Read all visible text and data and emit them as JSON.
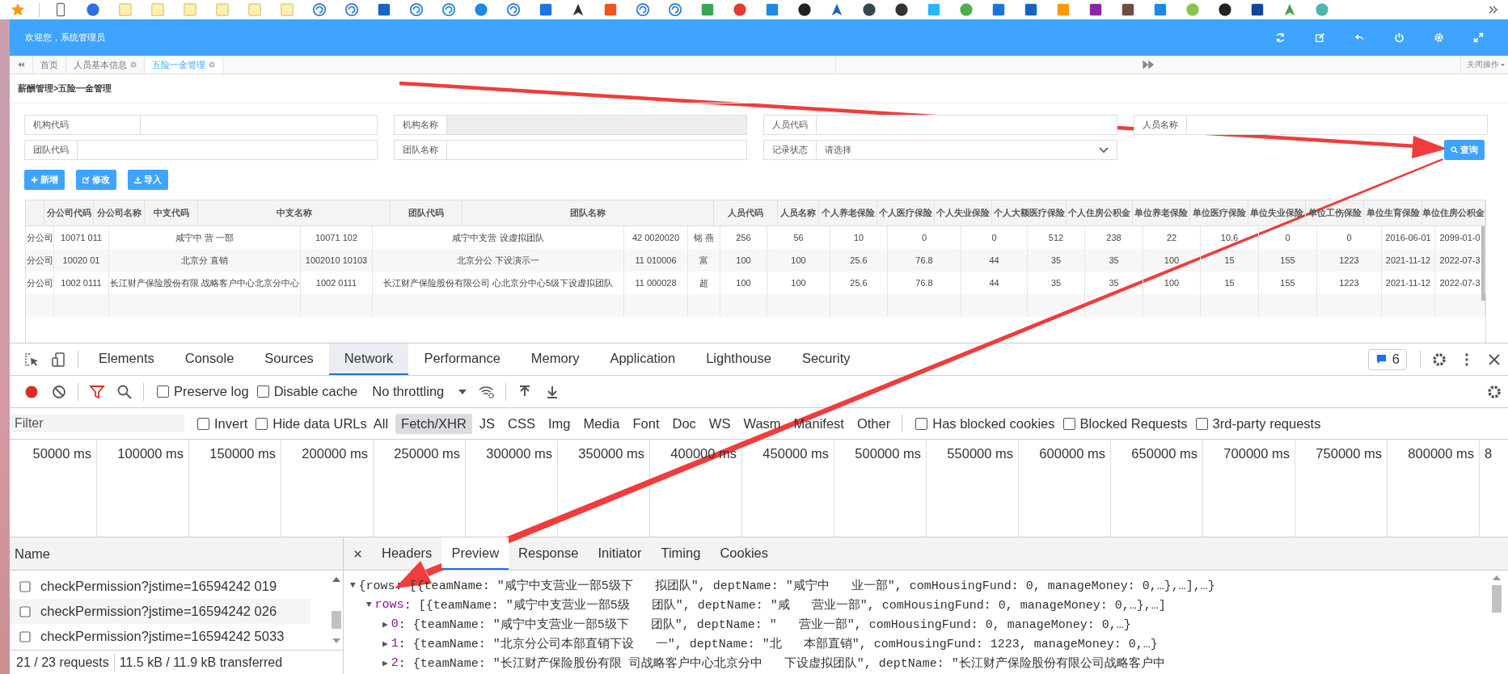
{
  "header": {
    "welcome": "欢迎您，系统管理员"
  },
  "tabs": {
    "items": [
      {
        "label": "首页",
        "closable": false,
        "selected": false
      },
      {
        "label": "人员基本信息",
        "closable": true,
        "selected": false
      },
      {
        "label": "五险一金管理",
        "closable": true,
        "selected": true
      }
    ],
    "close_menu": "关闭操作"
  },
  "breadcrumb": "薪酬管理>五险一金管理",
  "filters": [
    {
      "label": "机构代码",
      "kind": "text"
    },
    {
      "label": "机构名称",
      "kind": "readonly"
    },
    {
      "label": "人员代码",
      "kind": "text"
    },
    {
      "label": "人员名称",
      "kind": "text"
    },
    {
      "label": "团队代码",
      "kind": "text"
    },
    {
      "label": "团队名称",
      "kind": "text"
    },
    {
      "label": "记录状态",
      "kind": "select",
      "value": "请选择"
    }
  ],
  "search_button": "查询",
  "buttons": [
    "新增",
    "修改",
    "导入"
  ],
  "table": {
    "columns": [
      "",
      "分公司代码",
      "分公司名称",
      "中支代码",
      "中支名称",
      "团队代码",
      "团队名称",
      "人员代码",
      "人员名称",
      "个人养老保险",
      "个人医疗保险",
      "个人失业保险",
      "个人大额医疗保险",
      "个人住房公积金",
      "单位养老保险",
      "单位医疗保险",
      "单位失业保险",
      "单位工伤保险",
      "单位生育保险",
      "单位住房公积金"
    ],
    "rows": [
      [
        "分公司",
        "10071 011",
        "咸宁中 营 一部",
        "10071 102",
        "咸宁中支营  设虚拟团队",
        "42 0020020",
        "铭 燕",
        "256",
        "56",
        "10",
        "0",
        "0",
        "512",
        "238",
        "22",
        "10.6",
        "0",
        "0",
        "2016-06-01",
        "2099-01-0"
      ],
      [
        "分公司",
        "10020 01",
        "北京分  直销",
        "1002010 10103",
        "北京分公  下设演示一",
        "11 010006",
        "富",
        "100",
        "100",
        "25.6",
        "76.8",
        "44",
        "35",
        "35",
        "100",
        "15",
        "155",
        "1223",
        "2021-11-12",
        "2022-07-3"
      ],
      [
        "分公司",
        "1002 0111",
        "长江财产保险股份有限 战略客户中心北京分中心",
        "1002 0111",
        "长江财产保险股份有限公司 心北京分中心5级下设虚拟团队",
        "11 000028",
        "超",
        "100",
        "100",
        "25.6",
        "76.8",
        "44",
        "35",
        "35",
        "100",
        "15",
        "155",
        "1223",
        "2021-11-12",
        "2022-07-3"
      ]
    ]
  },
  "devtools": {
    "panels": [
      {
        "label": "Elements",
        "selected": false
      },
      {
        "label": "Console",
        "selected": false
      },
      {
        "label": "Sources",
        "selected": false
      },
      {
        "label": "Network",
        "selected": true
      },
      {
        "label": "Performance",
        "selected": false
      },
      {
        "label": "Memory",
        "selected": false
      },
      {
        "label": "Application",
        "selected": false
      },
      {
        "label": "Lighthouse",
        "selected": false
      },
      {
        "label": "Security",
        "selected": false
      }
    ],
    "issues_count": "6",
    "toolbar": {
      "checks": [
        {
          "label": "Preserve log",
          "checked": false
        },
        {
          "label": "Disable cache",
          "checked": false
        }
      ],
      "throttling": "No throttling"
    },
    "filter": {
      "placeholder": "Filter",
      "checks_before": [
        {
          "label": "Invert",
          "checked": false
        },
        {
          "label": "Hide data URLs",
          "checked": false
        }
      ],
      "types": [
        {
          "label": "All",
          "selected": false
        },
        {
          "label": "Fetch/XHR",
          "selected": true
        },
        {
          "label": "JS",
          "selected": false
        },
        {
          "label": "CSS",
          "selected": false
        },
        {
          "label": "Img",
          "selected": false
        },
        {
          "label": "Media",
          "selected": false
        },
        {
          "label": "Font",
          "selected": false
        },
        {
          "label": "Doc",
          "selected": false
        },
        {
          "label": "WS",
          "selected": false
        },
        {
          "label": "Wasm",
          "selected": false
        },
        {
          "label": "Manifest",
          "selected": false
        },
        {
          "label": "Other",
          "selected": false
        }
      ],
      "checks_after": [
        {
          "label": "Has blocked cookies",
          "checked": false
        },
        {
          "label": "Blocked Requests",
          "checked": false
        },
        {
          "label": "3rd-party requests",
          "checked": false
        }
      ]
    },
    "timeline_ticks": [
      "50000 ms",
      "100000 ms",
      "150000 ms",
      "200000 ms",
      "250000 ms",
      "300000 ms",
      "350000 ms",
      "400000 ms",
      "450000 ms",
      "500000 ms",
      "550000 ms",
      "600000 ms",
      "650000 ms",
      "700000 ms",
      "750000 ms",
      "800000 ms",
      "8"
    ],
    "requests": {
      "header": "Name",
      "items": [
        "checkPermission?jstime=16594242 019",
        "checkPermission?jstime=16594242 026",
        "checkPermission?jstime=16594242 5033"
      ],
      "summary": [
        "21 / 23 requests",
        "11.5 kB / 11.9 kB transferred"
      ]
    },
    "detail_tabs": [
      {
        "label": "Headers",
        "selected": false
      },
      {
        "label": "Preview",
        "selected": true
      },
      {
        "label": "Response",
        "selected": false
      },
      {
        "label": "Initiator",
        "selected": false
      },
      {
        "label": "Timing",
        "selected": false
      },
      {
        "label": "Cookies",
        "selected": false
      }
    ],
    "preview": [
      {
        "toggle": "▼",
        "text": "{rows: [{teamName: \"咸宁中支营业一部5级下   拟团队\", deptName: \"咸宁中   业一部\", comHousingFund: 0, manageMoney: 0,…},…],…}",
        "children": [
          {
            "toggle": "▼",
            "key": "rows",
            "text": ": [{teamName: \"咸宁中支营业一部5级   团队\", deptName: \"咸   营业一部\", comHousingFund: 0, manageMoney: 0,…},…]",
            "children": [
              {
                "toggle": "▶",
                "key": "0",
                "text": ": {teamName: \"咸宁中支营业一部5级下   团队\", deptName: \"   营业一部\", comHousingFund: 0, manageMoney: 0,…}"
              },
              {
                "toggle": "▶",
                "key": "1",
                "text": ": {teamName: \"北京分公司本部直销下设   一\", deptName: \"北   本部直销\", comHousingFund: 1223, manageMoney: 0,…}"
              },
              {
                "toggle": "▶",
                "key": "2",
                "text": ": {teamName: \"长江财产保险股份有限 司战略客户中心北京分中   下设虚拟团队\", deptName: \"长江财产保险股份有限公司战略客户中"
              }
            ]
          }
        ]
      }
    ]
  }
}
